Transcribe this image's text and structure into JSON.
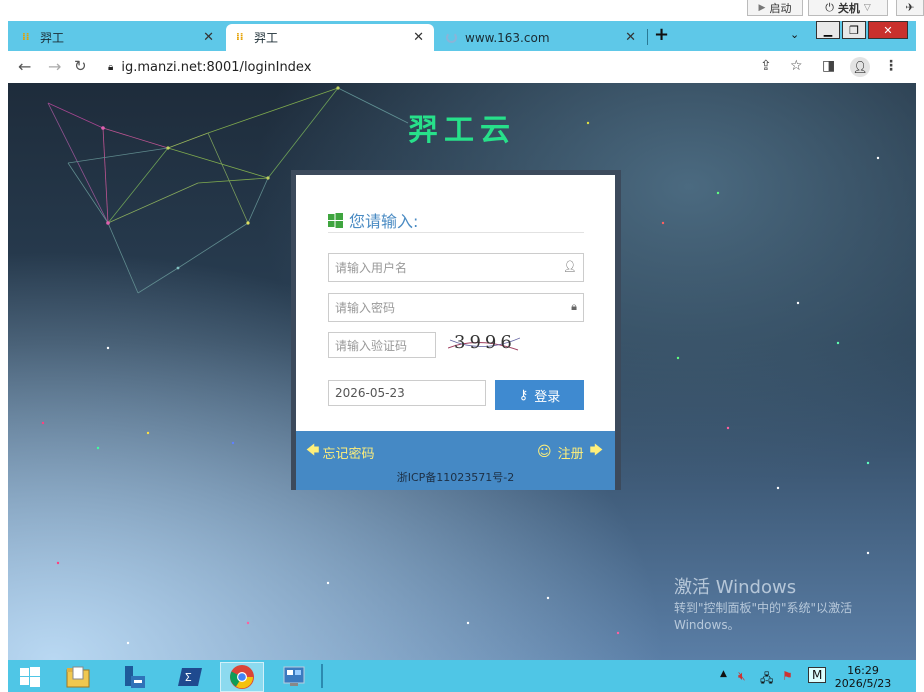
{
  "host": {
    "start_label": "启动",
    "shutdown_label": "关机"
  },
  "browser": {
    "tabs": [
      {
        "title": "羿工",
        "active": false
      },
      {
        "title": "羿工",
        "active": true
      },
      {
        "title": "www.163.com",
        "active": false,
        "loading": true
      }
    ],
    "new_tab": "+",
    "url": "ig.manzi.net:8001/loginIndex"
  },
  "page": {
    "brand": "羿工云",
    "login": {
      "title": "您请输入:",
      "username_placeholder": "请输入用户名",
      "password_placeholder": "请输入密码",
      "captcha_placeholder": "请输入验证码",
      "captcha_text": "3996",
      "date_value": "2026-05-23",
      "login_label": "登录",
      "forgot_label": "忘记密码",
      "register_label": "注册",
      "icp": "浙ICP备11023571号-2"
    },
    "activation": {
      "title": "激活 Windows",
      "line1": "转到\"控制面板\"中的\"系统\"以激活",
      "line2": "Windows。"
    }
  },
  "taskbar": {
    "tray_input": "M",
    "time": "16:29",
    "date": "2026/5/23"
  },
  "colors": {
    "brand": "#27e08a",
    "accent": "#3f8ad0",
    "footer": "#4589c5",
    "link": "#ffef7a"
  }
}
